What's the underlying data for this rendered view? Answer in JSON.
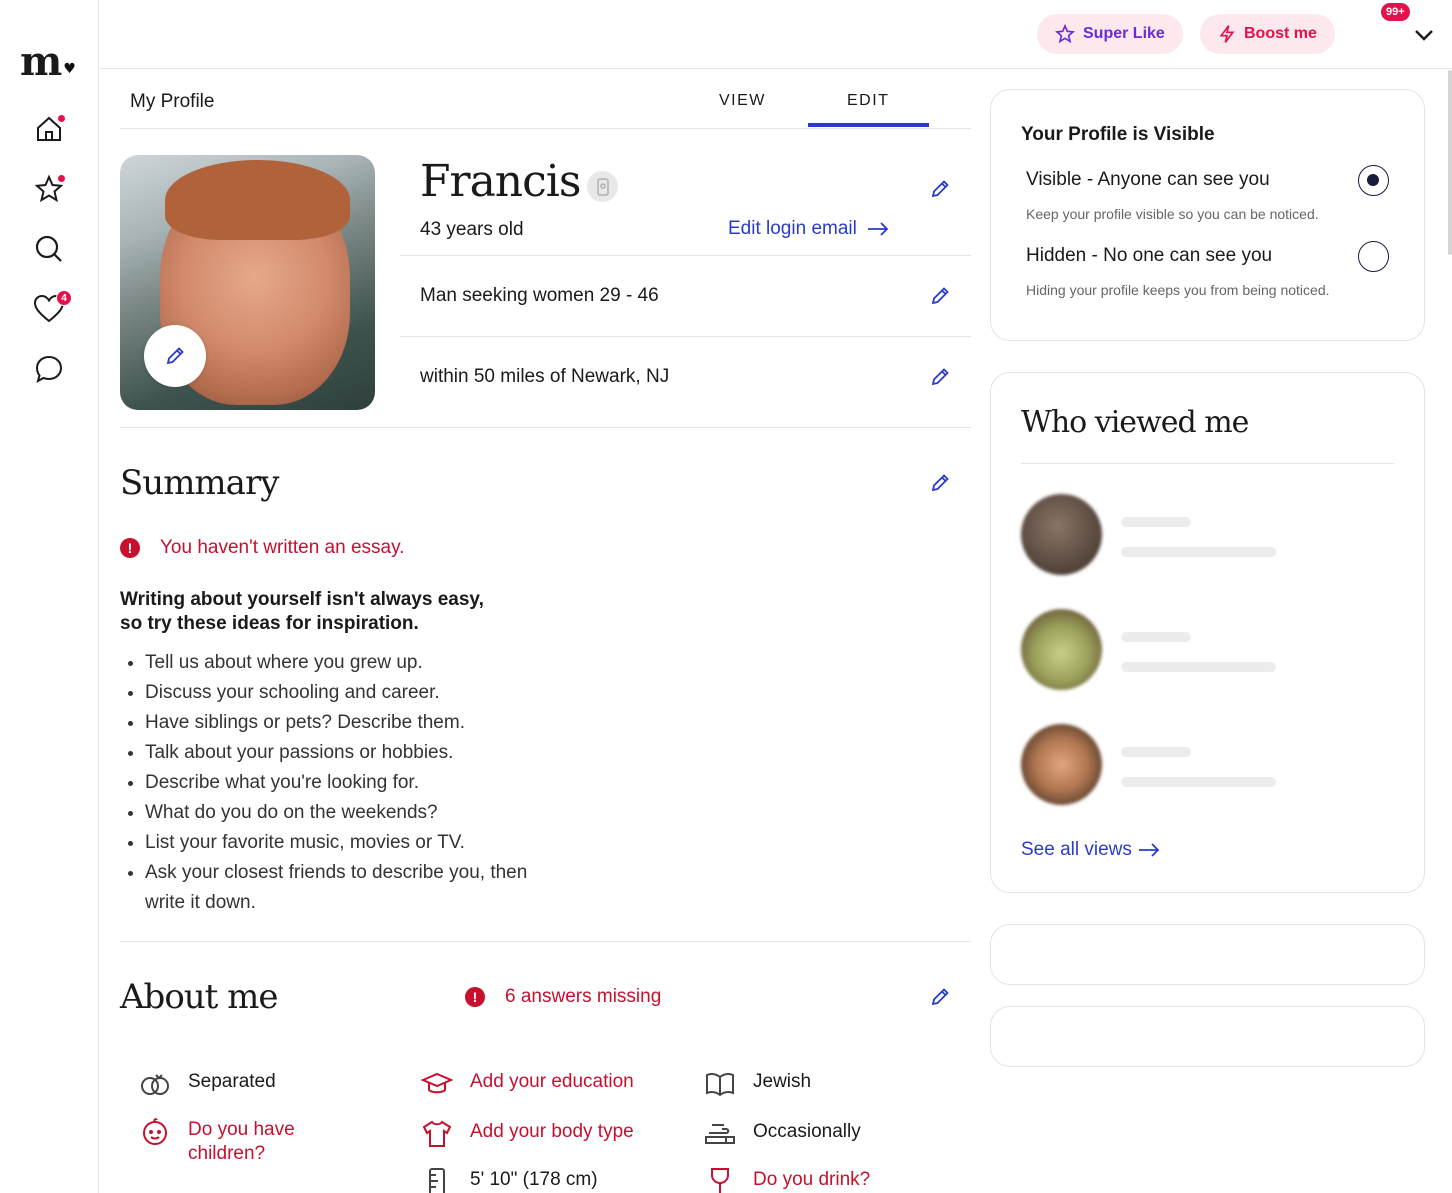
{
  "logo": {
    "text": "m",
    "heart": "♥"
  },
  "nav": {
    "items": [
      {
        "name": "home",
        "dot": true
      },
      {
        "name": "favorites",
        "dot": true
      },
      {
        "name": "search",
        "dot": false
      },
      {
        "name": "likes",
        "badge": "4"
      },
      {
        "name": "messages",
        "dot": false
      }
    ]
  },
  "topbar": {
    "super_like": "Super Like",
    "boost": "Boost me",
    "notification_badge": "99+"
  },
  "tabs": {
    "page_title": "My Profile",
    "view": "VIEW",
    "edit": "EDIT",
    "active": "edit"
  },
  "profile": {
    "name": "Francis",
    "age": "43 years old",
    "edit_email": "Edit login email",
    "seeking": "Man seeking women 29 - 46",
    "location": "within 50 miles of Newark, NJ"
  },
  "summary": {
    "title": "Summary",
    "warning": "You haven't written an essay.",
    "inspiration_line1": "Writing about yourself isn't always easy,",
    "inspiration_line2": "so try these ideas for inspiration.",
    "ideas": [
      "Tell us about where you grew up.",
      "Discuss your schooling and career.",
      "Have siblings or pets? Describe them.",
      "Talk about your passions or hobbies.",
      "Describe what you're looking for.",
      "What do you do on the weekends?",
      "List your favorite music, movies or TV.",
      "Ask your closest friends to describe you, then write it down."
    ]
  },
  "about": {
    "title": "About me",
    "missing": "6 answers missing",
    "items": [
      {
        "label": "Separated",
        "icon": "rings-icon",
        "missing": false
      },
      {
        "label": "Add your education",
        "icon": "graduation-cap-icon",
        "missing": true
      },
      {
        "label": "Jewish",
        "icon": "book-icon",
        "missing": false
      },
      {
        "label": "Do you have children?",
        "icon": "baby-face-icon",
        "missing": true
      },
      {
        "label": "Add your body type",
        "icon": "shirt-icon",
        "missing": true
      },
      {
        "label": "Occasionally",
        "icon": "smoking-icon",
        "missing": false
      },
      {
        "label": "5' 10\" (178 cm)",
        "icon": "ruler-icon",
        "missing": false
      },
      {
        "label": "Do you drink?",
        "icon": "wine-glass-icon",
        "missing": true
      }
    ]
  },
  "visibility": {
    "title": "Your Profile is Visible",
    "visible_label": "Visible - Anyone can see you",
    "visible_sub": "Keep your profile visible so you can be noticed.",
    "hidden_label": "Hidden - No one can see you",
    "hidden_sub": "Hiding your profile keeps you from being noticed.",
    "selected": "visible"
  },
  "viewers": {
    "title": "Who viewed me",
    "see_all": "See all views",
    "colors": [
      "#6b5a4e",
      "#a3a865",
      "#b57a5c"
    ]
  },
  "colors": {
    "accent_blue": "#2a3bcc",
    "alert_red": "#c8102e",
    "pink": "#e2134c"
  }
}
